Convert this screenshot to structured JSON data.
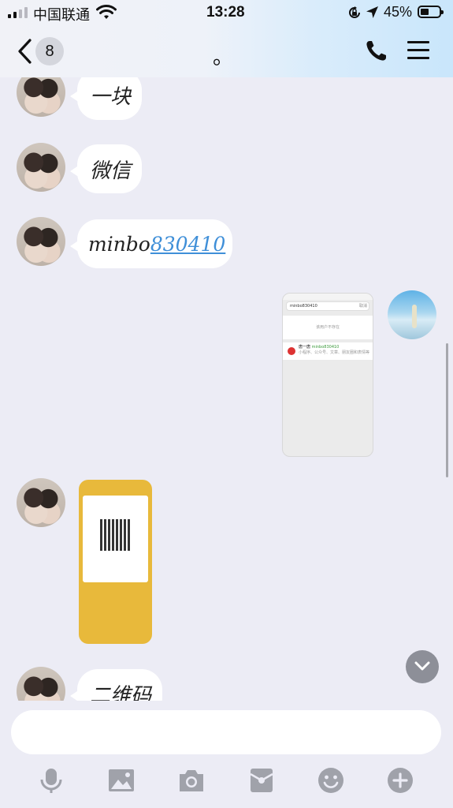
{
  "status_bar": {
    "carrier": "中国联通",
    "time": "13:28",
    "battery_percent": "45%",
    "battery_level": 0.45,
    "icons": [
      "signal-icon",
      "wifi-icon",
      "rotation-lock-icon",
      "location-icon",
      "battery-icon"
    ]
  },
  "nav": {
    "unread_count": "8",
    "title": "。",
    "icons": [
      "back-icon",
      "phone-icon",
      "menu-icon"
    ]
  },
  "messages": [
    {
      "from": "other",
      "type": "text",
      "text": "一块"
    },
    {
      "from": "other",
      "type": "text",
      "text": "微信"
    },
    {
      "from": "other",
      "type": "text",
      "text_prefix": "minbo",
      "link": "830410"
    },
    {
      "from": "self",
      "type": "image",
      "image": "search-screenshot",
      "image_text": {
        "query": "minbo830410",
        "cancel": "取消",
        "empty": "该用户不存在",
        "result_name": "唐一唐",
        "result_id": "minbo830410",
        "result_desc": "小程序、公众号、文章、朋友圈和表情等"
      }
    },
    {
      "from": "other",
      "type": "image",
      "image": "qr-code-screenshot"
    },
    {
      "from": "other",
      "type": "text",
      "text": "二维码"
    }
  ],
  "input": {
    "value": "",
    "placeholder": ""
  },
  "toolbar": [
    "microphone-icon",
    "image-icon",
    "camera-icon",
    "red-packet-icon",
    "emoji-icon",
    "plus-icon"
  ],
  "colors": {
    "accent_link": "#3f8fd8",
    "background": "#ececf5",
    "bubble": "#ffffff"
  }
}
